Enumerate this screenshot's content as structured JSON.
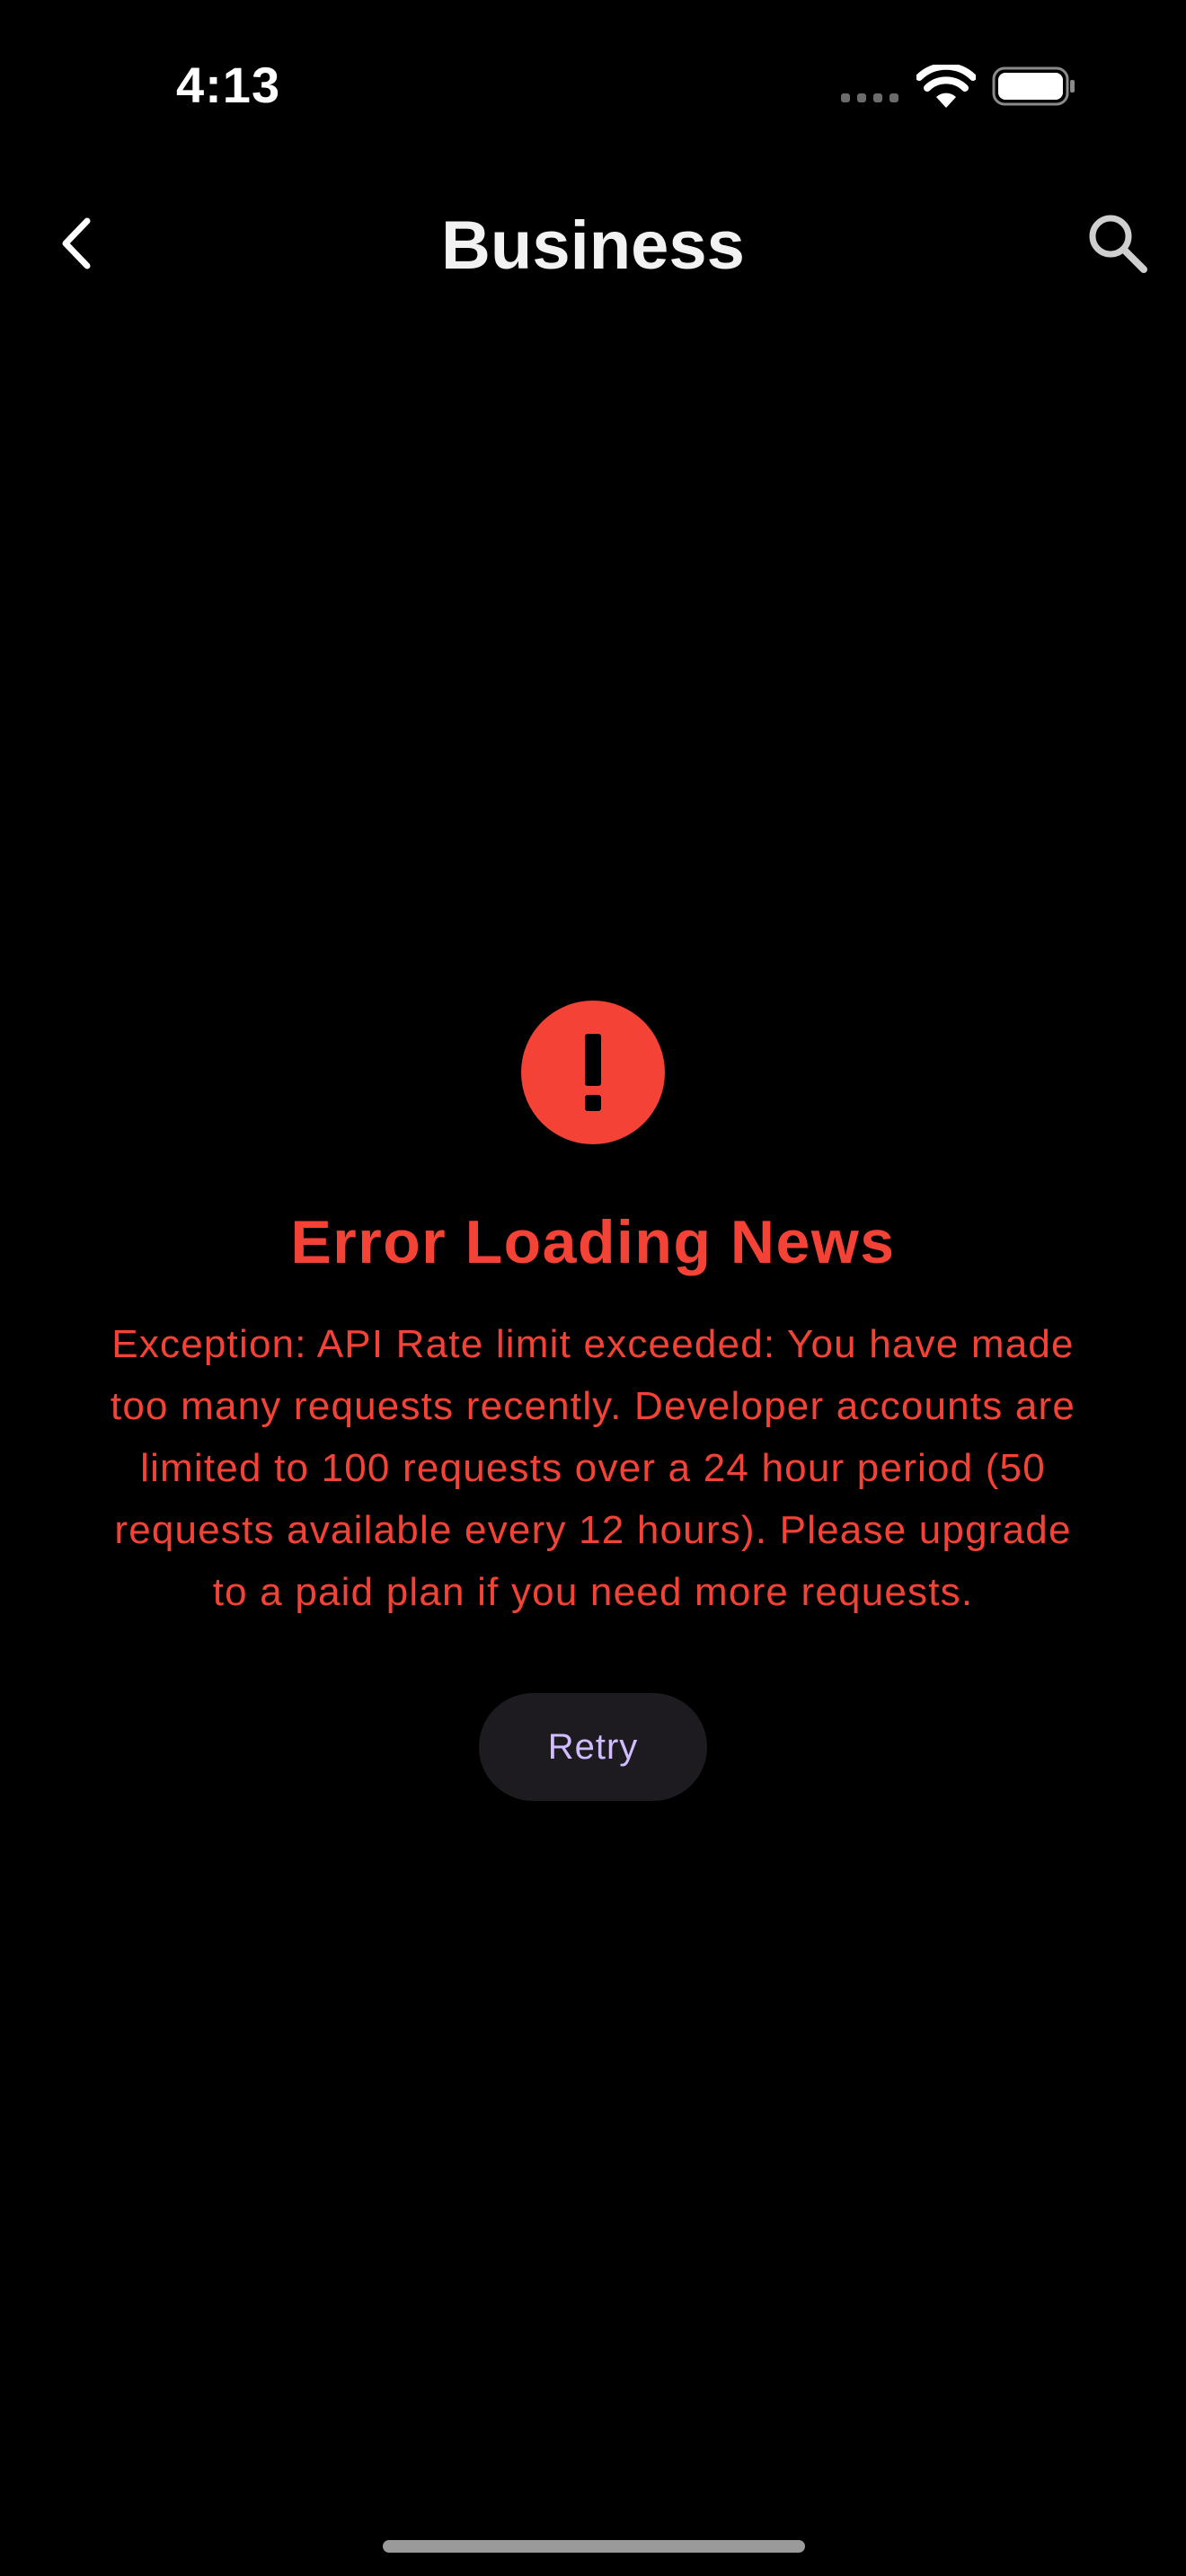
{
  "status_bar": {
    "time": "4:13"
  },
  "nav": {
    "title": "Business",
    "back_icon": "chevron-left-icon",
    "search_icon": "search-icon"
  },
  "error": {
    "icon": "exclamation-icon",
    "title": "Error Loading News",
    "message": "Exception: API Rate limit exceeded: You have made too many requests recently. Developer accounts are limited to 100 requests over a 24 hour period (50 requests available every 12 hours). Please upgrade to a paid plan if you need more requests.",
    "retry_label": "Retry"
  },
  "colors": {
    "background": "#000000",
    "error": "#f44336",
    "retry_text": "#d0bcff",
    "retry_background": "#1d1b20"
  }
}
